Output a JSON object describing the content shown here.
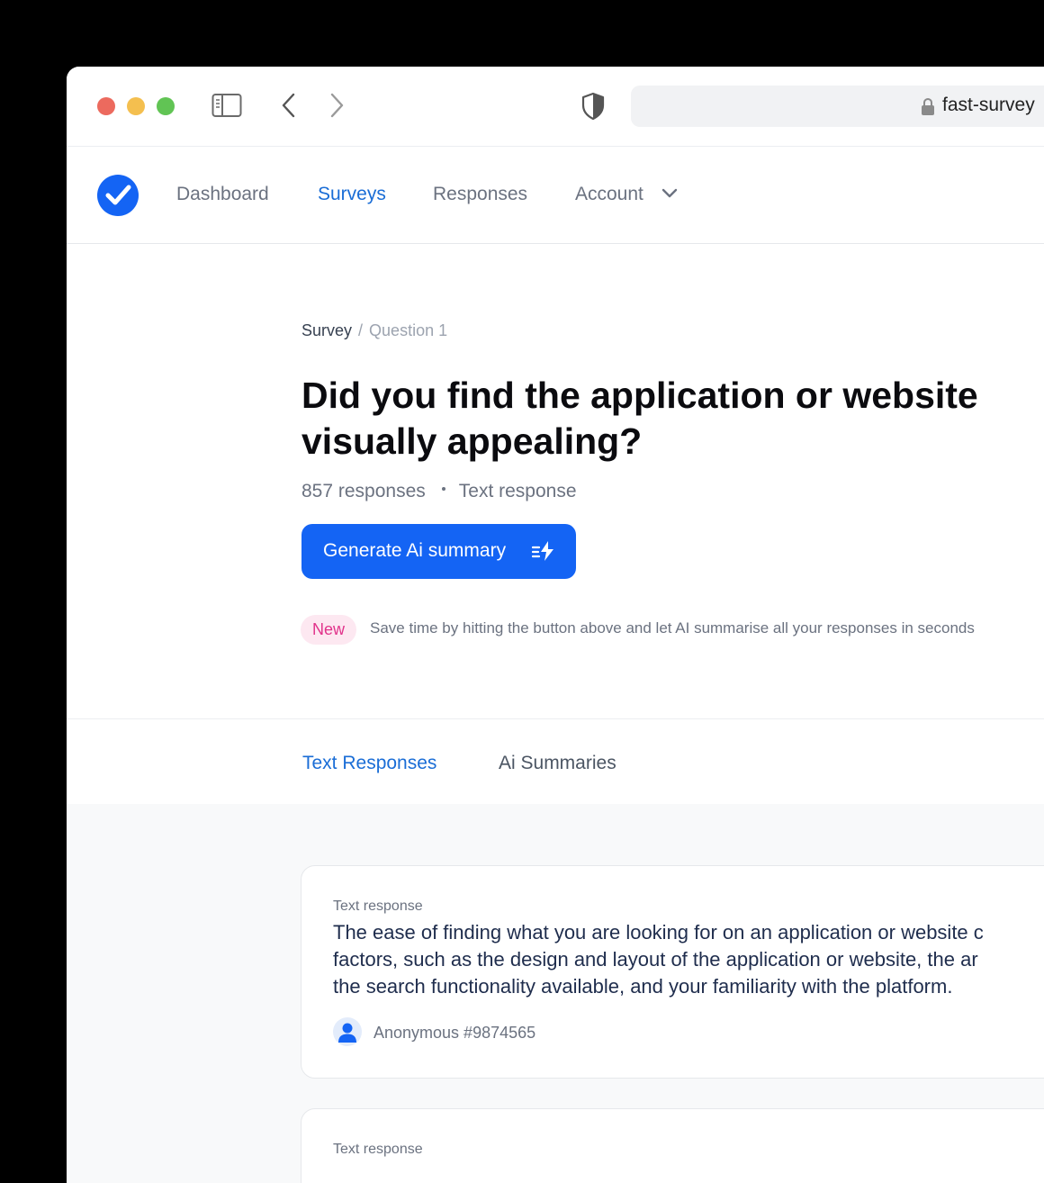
{
  "browser": {
    "url": "fast-survey"
  },
  "nav": {
    "items": [
      {
        "label": "Dashboard"
      },
      {
        "label": "Surveys"
      },
      {
        "label": "Responses"
      },
      {
        "label": "Account"
      }
    ],
    "active": "Surveys"
  },
  "breadcrumb": {
    "root": "Survey",
    "separator": "/",
    "current": "Question 1"
  },
  "question": {
    "title": "Did you find the application or website visually appealing?",
    "responses": "857 responses",
    "type": "Text response"
  },
  "generate_button": {
    "label": "Generate Ai summary"
  },
  "notice": {
    "badge": "New",
    "text": "Save time by hitting the button above and let AI summarise all your responses in seconds"
  },
  "tabs": [
    {
      "label": "Text Responses"
    },
    {
      "label": "Ai Summaries"
    }
  ],
  "responses": [
    {
      "label": "Text response",
      "lines": [
        "The ease of finding what you are looking for on an application or website c",
        "factors, such as the design and layout of the application or website, the ar",
        "the search functionality available, and your familiarity with the platform."
      ],
      "author": "Anonymous #9874565"
    },
    {
      "label": "Text response"
    }
  ],
  "colors": {
    "accent": "#1464f4",
    "active_nav": "#1a6dd6",
    "badge_bg": "#fde8f1",
    "badge_text": "#e1338b"
  }
}
